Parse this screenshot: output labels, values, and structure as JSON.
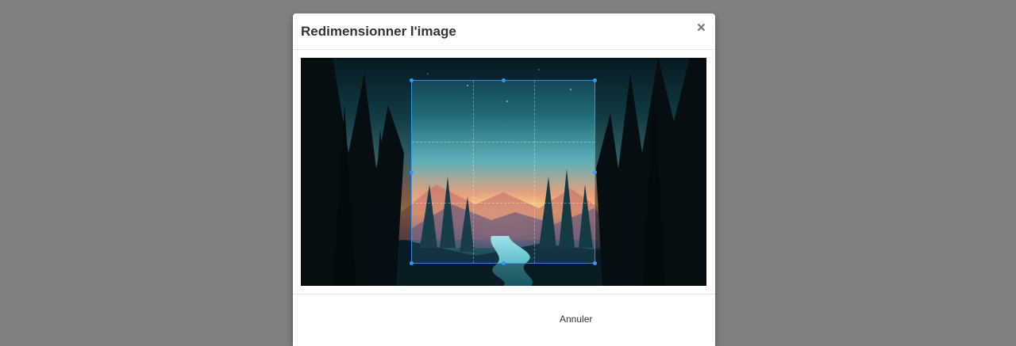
{
  "dialog": {
    "title": "Redimensionner l'image",
    "close_label": "×",
    "cancel_label": "Annuler"
  },
  "cropper": {
    "image_subject": "forest landscape at dusk",
    "accent_color": "#3399ff"
  }
}
